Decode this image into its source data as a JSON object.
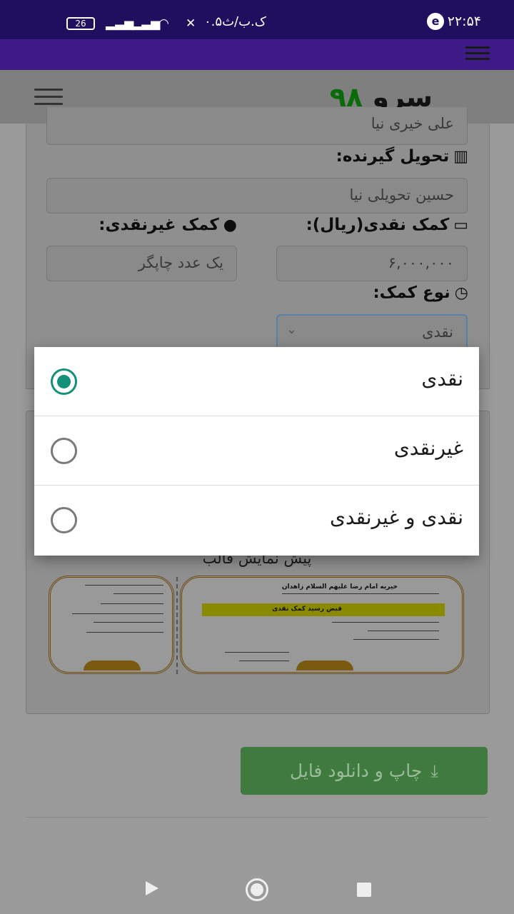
{
  "status_bar": {
    "time": "۲۲:۵۴",
    "date": "۰.۵ک.ب/ث",
    "battery": "26"
  },
  "header": {
    "logo_word": "سرو",
    "logo_number": "۹۸"
  },
  "form": {
    "donor_value": "علی خیری نیا",
    "receiver_label": "تحویل گیرنده:",
    "receiver_value": "حسین تحویلی نیا",
    "cash_label": "کمک نقدی(ریال):",
    "cash_value": "۶,۰۰۰,۰۰۰",
    "noncash_label": "کمک غیرنقدی:",
    "noncash_value": "یک عدد چاپگر",
    "type_label": "نوع کمک:",
    "type_value": "نقدی"
  },
  "preview": {
    "title": "پیش نمایش قالب",
    "receipt_header": "خیریه امام رضا علیهم السلام زاهدان",
    "receipt_subtitle": "قبض رسید کمک نقدی"
  },
  "download_button": "چاپ و دانلود فایل",
  "dialog": {
    "options": [
      {
        "label": "نقدی",
        "selected": true
      },
      {
        "label": "غیرنقدی",
        "selected": false
      },
      {
        "label": "نقدی و غیرنقدی",
        "selected": false
      }
    ]
  },
  "colors": {
    "status_bar": "#1f0f5e",
    "app_bar": "#3d1a86",
    "radio_accent": "#13907a",
    "button": "#3f7a3f"
  }
}
